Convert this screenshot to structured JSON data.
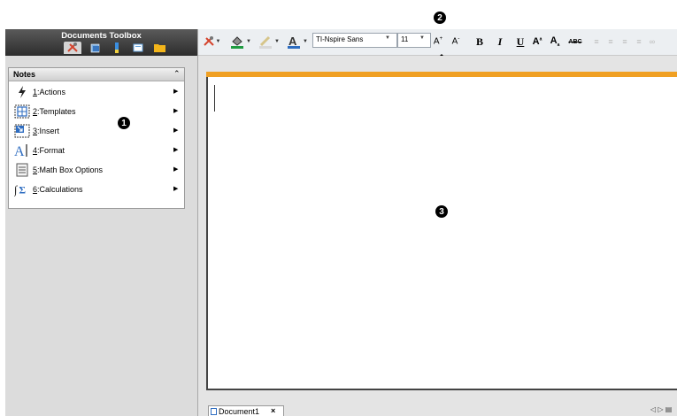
{
  "toolbox": {
    "title": "Documents Toolbox",
    "tabs": [
      "tools-icon",
      "document-icon",
      "ruler-icon",
      "library-icon",
      "folder-icon"
    ]
  },
  "notes_panel": {
    "title": "Notes",
    "items": [
      {
        "key": "1",
        "label": ":Actions",
        "icon": "lightning-icon"
      },
      {
        "key": "2",
        "label": ":Templates",
        "icon": "templates-icon"
      },
      {
        "key": "3",
        "label": ":Insert",
        "icon": "insert-icon"
      },
      {
        "key": "4",
        "label": ":Format",
        "icon": "format-icon"
      },
      {
        "key": "5",
        "label": ":Math Box Options",
        "icon": "math-box-icon"
      },
      {
        "key": "6",
        "label": ":Calculations",
        "icon": "calculations-icon"
      }
    ]
  },
  "format_toolbar": {
    "font_name": "TI-Nspire Sans",
    "font_size": "11",
    "increase_size": "A",
    "decrease_size": "A",
    "bold": "B",
    "italic": "I",
    "underline": "U",
    "superscript": "A",
    "subscript": "A",
    "strikethrough": "ABC"
  },
  "callouts": {
    "one": "1",
    "two": "2",
    "three": "3"
  },
  "document": {
    "tab_label": "Document1",
    "tab_close": "×",
    "nav": "◁ ▷ ▤"
  }
}
